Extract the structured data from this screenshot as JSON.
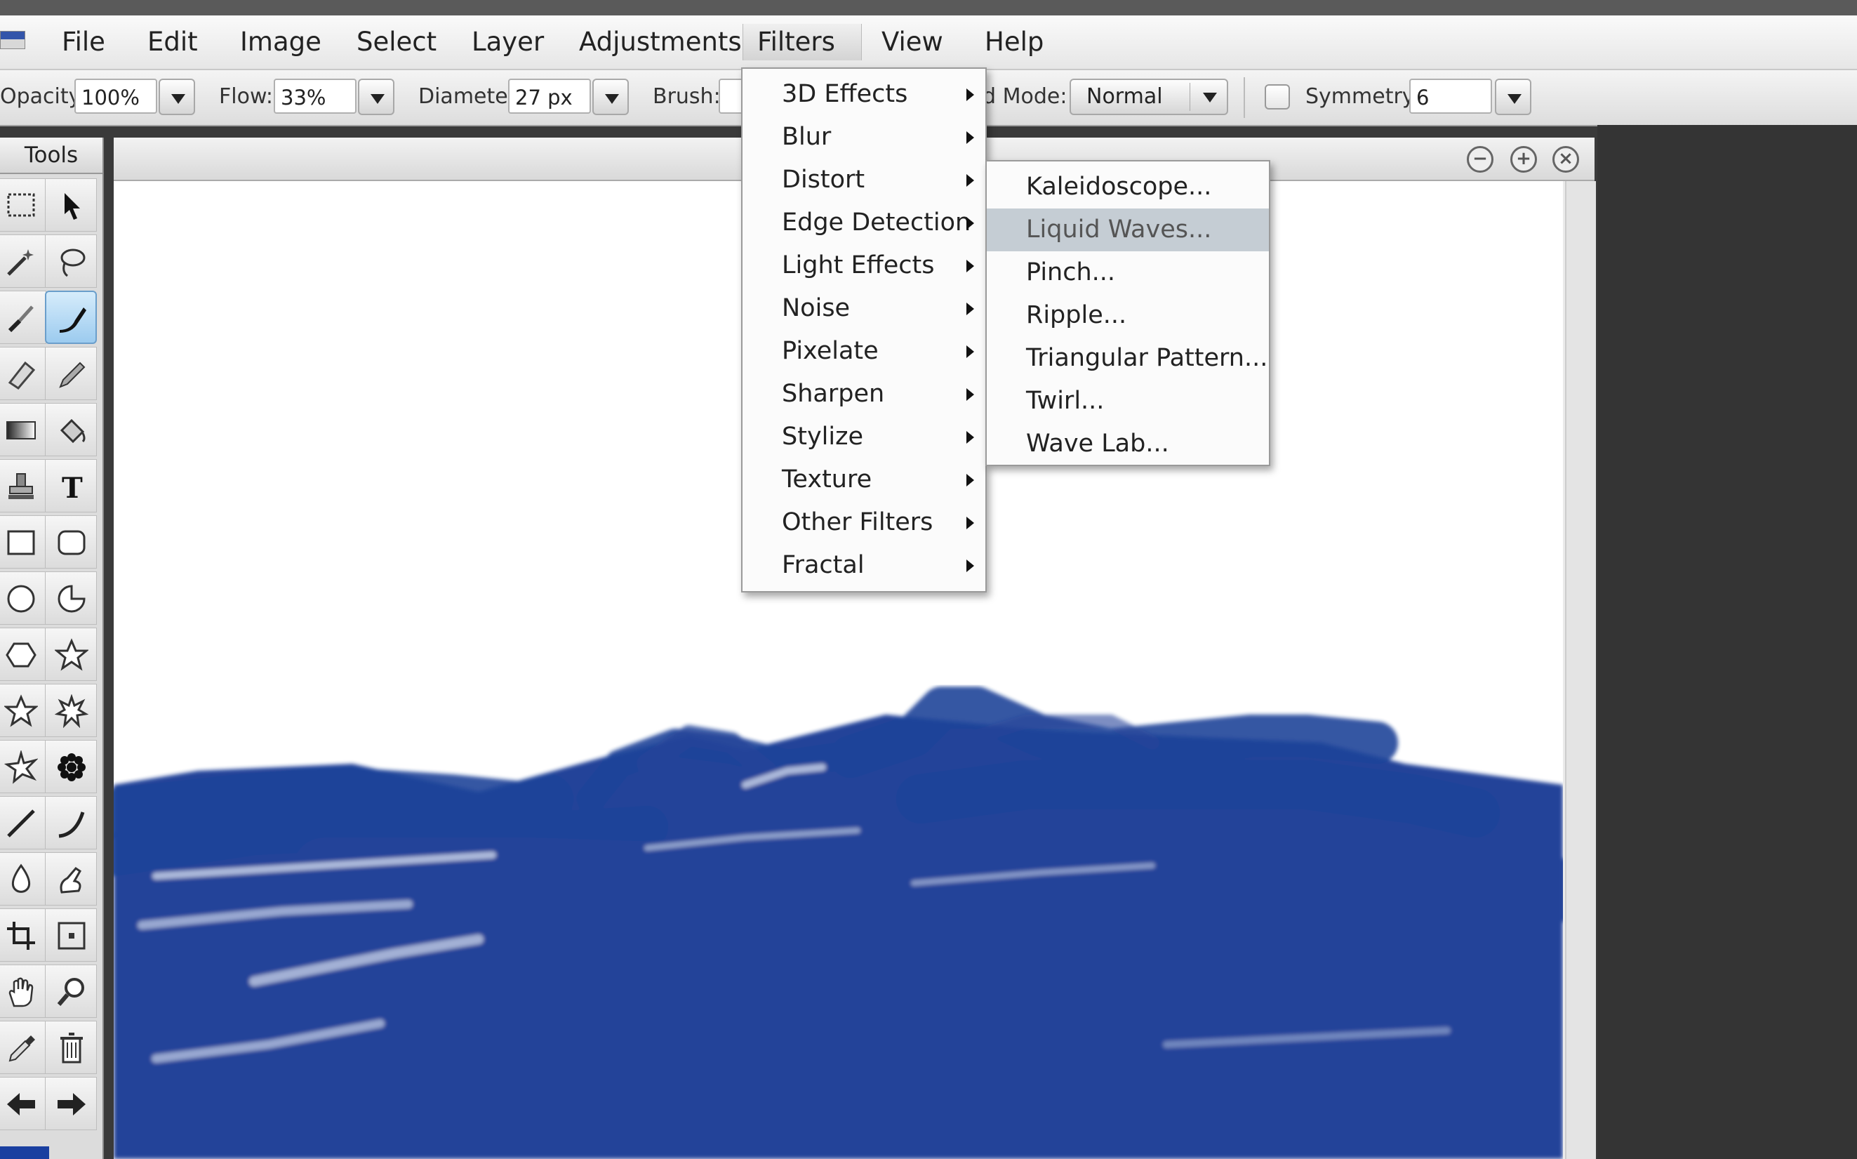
{
  "menubar": {
    "items": [
      "File",
      "Edit",
      "Image",
      "Select",
      "Layer",
      "Adjustments",
      "Filters",
      "View",
      "Help"
    ],
    "active": "Filters"
  },
  "options": {
    "opacity_label": "Opacity:",
    "opacity_value": "100%",
    "flow_label": "Flow:",
    "flow_value": "33%",
    "diameter_label": "Diameter:",
    "diameter_value": "27 px",
    "brush_label": "Brush:",
    "blend_label": "d Mode:",
    "blend_value": "Normal",
    "symmetry_label": "Symmetry",
    "symmetry_value": "6"
  },
  "tools": {
    "header": "Tools",
    "items": [
      "marquee",
      "move",
      "magic-wand",
      "lasso",
      "brush",
      "smudge",
      "eraser",
      "pencil",
      "gradient",
      "fill",
      "stamp",
      "text",
      "rectangle",
      "rounded-rect",
      "ellipse",
      "shape",
      "hexagon",
      "star",
      "star5",
      "burst",
      "star-outline",
      "flower",
      "line",
      "curve",
      "drop",
      "finger",
      "crop",
      "transform",
      "hand",
      "zoom",
      "eyedropper",
      "trash",
      "back-arrow",
      "forward-arrow"
    ],
    "selected": "smudge",
    "foreground_color": "#1a3fa0"
  },
  "filters_menu": {
    "items": [
      "3D Effects",
      "Blur",
      "Distort",
      "Edge Detection",
      "Light Effects",
      "Noise",
      "Pixelate",
      "Sharpen",
      "Stylize",
      "Texture",
      "Other Filters",
      "Fractal"
    ]
  },
  "distort_submenu": {
    "items": [
      "Kaleidoscope...",
      "Liquid Waves...",
      "Pinch...",
      "Ripple...",
      "Triangular Pattern...",
      "Twirl...",
      "Wave Lab..."
    ],
    "highlighted": "Liquid Waves..."
  },
  "canvas": {
    "paint_color": "#1a3d96"
  }
}
